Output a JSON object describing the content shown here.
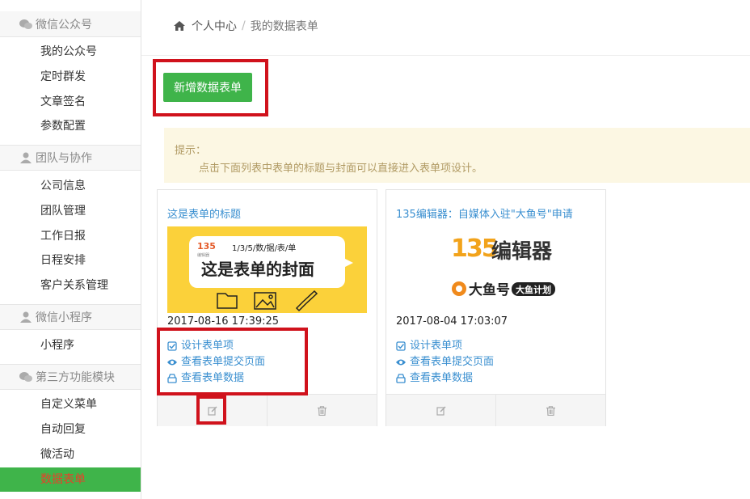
{
  "sidebar": {
    "groups": [
      {
        "title": "微信公众号",
        "icon": "wechat-icon",
        "items": [
          "我的公众号",
          "定时群发",
          "文章签名",
          "参数配置"
        ]
      },
      {
        "title": "团队与协作",
        "icon": "user-icon",
        "items": [
          "公司信息",
          "团队管理",
          "工作日报",
          "日程安排",
          "客户关系管理"
        ]
      },
      {
        "title": "微信小程序",
        "icon": "user-icon",
        "items": [
          "小程序"
        ]
      },
      {
        "title": "第三方功能模块",
        "icon": "wechat-icon",
        "items": [
          "自定义菜单",
          "自动回复",
          "微活动",
          "数据表单"
        ]
      }
    ],
    "active_item": "数据表单"
  },
  "breadcrumb": {
    "home": "个人中心",
    "current": "我的数据表单"
  },
  "add_button": "新增数据表单",
  "tip": {
    "label": "提示：",
    "message": "点击下面列表中表单的标题与封面可以直接进入表单项设计。"
  },
  "cards": [
    {
      "title": "这是表单的标题",
      "cover": {
        "logo": "135",
        "logo_sub": "编辑器",
        "steps": "1/3/5/数/据/表/单",
        "headline": "这是表单的封面"
      },
      "date": "2017-08-16 17:39:25",
      "links": [
        "设计表单项",
        "查看表单提交页面",
        "查看表单数据"
      ]
    },
    {
      "title": "135编辑器：自媒体入驻\"大鱼号\"申请",
      "cover": {
        "logo": "135",
        "logo_text": "编辑器",
        "brand": "大鱼号",
        "badge": "大鱼计划"
      },
      "date": "2017-08-04 17:03:07",
      "links": [
        "设计表单项",
        "查看表单提交页面",
        "查看表单数据"
      ]
    }
  ],
  "colors": {
    "green": "#3fb44a",
    "link": "#3a8fd0",
    "highlight_red": "#d0121c",
    "cover_yellow": "#fbd13a"
  }
}
